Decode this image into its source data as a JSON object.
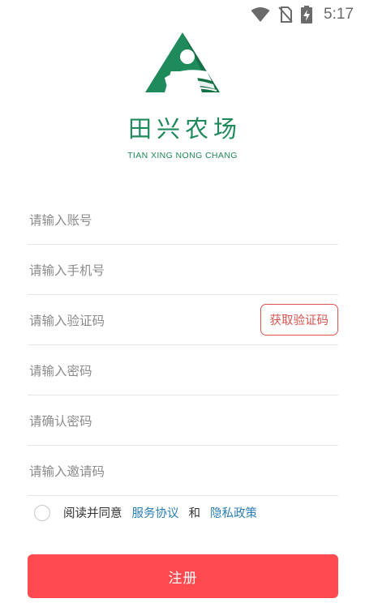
{
  "status_bar": {
    "time": "5:17",
    "icons": [
      "wifi-icon",
      "no-sim-icon",
      "battery-charging-icon"
    ]
  },
  "brand": {
    "name_cn": "田兴农场",
    "name_en": "TIAN XING NONG CHANG",
    "logo_colors": {
      "primary": "#1f8a5b",
      "dark": "#157046"
    }
  },
  "form": {
    "account_placeholder": "请输入账号",
    "phone_placeholder": "请输入手机号",
    "code_placeholder": "请输入验证码",
    "get_code_label": "获取验证码",
    "password_placeholder": "请输入密码",
    "confirm_password_placeholder": "请确认密码",
    "invite_placeholder": "请输入邀请码"
  },
  "agreement": {
    "prefix": "阅读并同意",
    "service_link": "服务协议",
    "and": "和",
    "privacy_link": "隐私政策",
    "checked": false
  },
  "submit": {
    "label": "注册",
    "color": "#ff4a4f"
  }
}
